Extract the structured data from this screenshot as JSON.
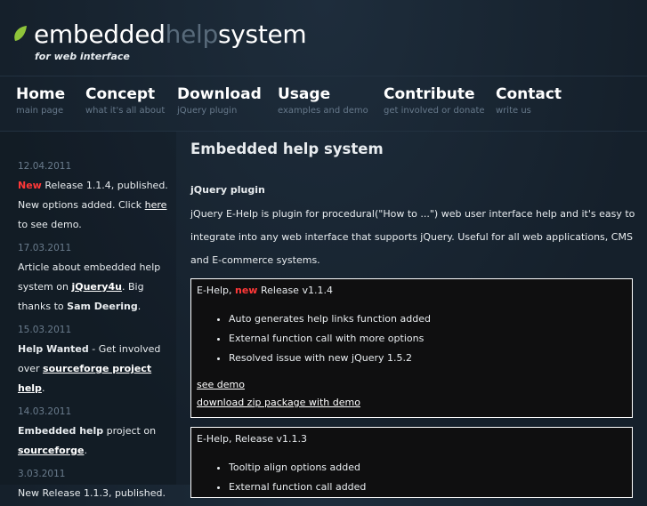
{
  "logo": {
    "part1": "embedded",
    "part2": "help",
    "part3": "system",
    "tagline": "for web interface"
  },
  "nav": [
    {
      "title": "Home",
      "sub": "main page"
    },
    {
      "title": "Concept",
      "sub": "what it's all about"
    },
    {
      "title": "Download",
      "sub": "jQuery plugin"
    },
    {
      "title": "Usage",
      "sub": "examples and demo"
    },
    {
      "title": "Contribute",
      "sub": "get involved or donate"
    },
    {
      "title": "Contact",
      "sub": "write us"
    }
  ],
  "news": [
    {
      "date": "12.04.2011",
      "new_label": "New",
      "text1": " Release 1.1.4, published. New options added. Click ",
      "link": "here",
      "text2": " to see demo."
    },
    {
      "date": "17.03.2011",
      "text1": "Article about embedded help system on ",
      "link": "jQuery4u",
      "text2": ". Big thanks to ",
      "bold": "Sam Deering",
      "text3": "."
    },
    {
      "date": "15.03.2011",
      "bold": "Help Wanted",
      "text1": " - Get involved over ",
      "link": "sourceforge project help",
      "text2": "."
    },
    {
      "date": "14.03.2011",
      "bold": "Embedded help",
      "text1": " project on ",
      "link": "sourceforge",
      "text2": "."
    },
    {
      "date": "3.03.2011",
      "text1": "New Release 1.1.3, published."
    }
  ],
  "main": {
    "title": "Embedded help system",
    "subtitle": "jQuery plugin",
    "intro": "jQuery E-Help is plugin for procedural(\"How to ...\") web user interface help and it's easy to integrate into any web interface that supports jQuery. Useful for all web applications, CMS and E-commerce systems.",
    "releases": [
      {
        "prefix": "E-Help, ",
        "new_label": "new",
        "title": " Release v1.1.4",
        "items": [
          "Auto generates help links function added",
          "External function call with more options",
          "Resolved issue with new jQuery 1.5.2"
        ],
        "demo_link": "see demo",
        "download_link": "download zip package with demo"
      },
      {
        "prefix": "E-Help, Release v1.1.3",
        "items": [
          "Tooltip align options added",
          "External function call added"
        ]
      }
    ]
  }
}
